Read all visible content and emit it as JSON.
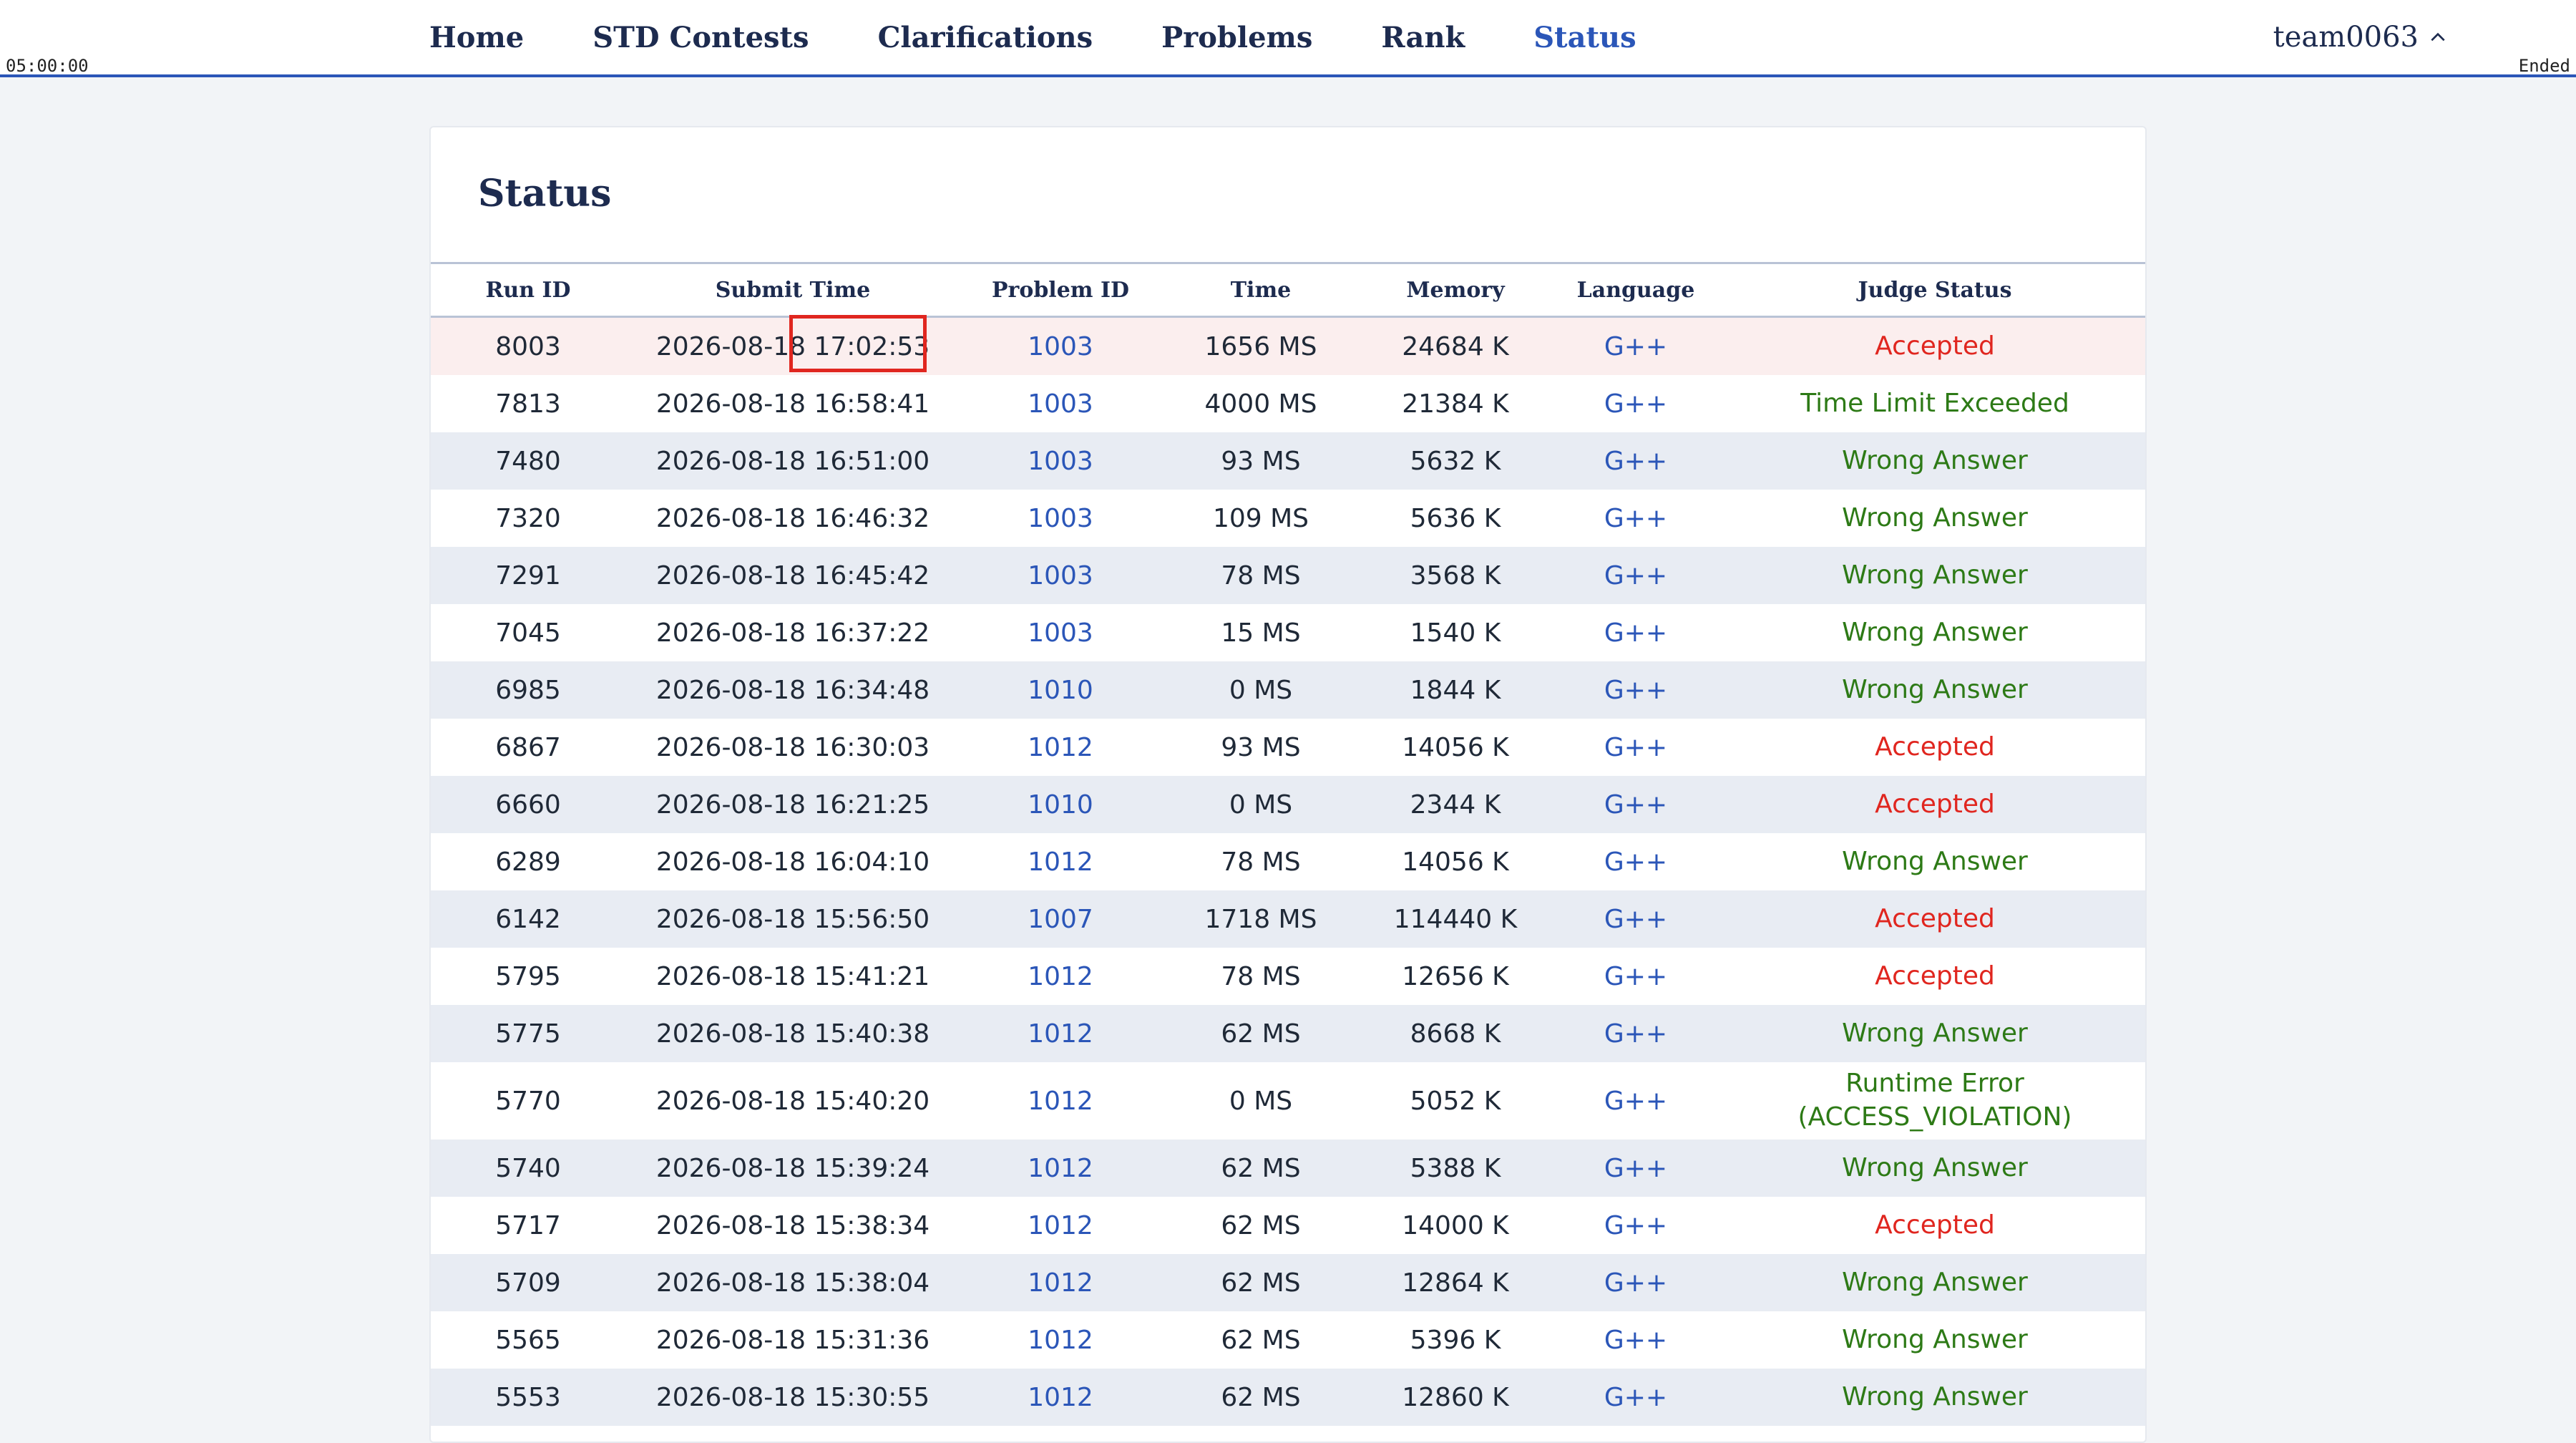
{
  "nav": {
    "items": [
      {
        "label": "Home",
        "active": false
      },
      {
        "label": "STD Contests",
        "active": false
      },
      {
        "label": "Clarifications",
        "active": false
      },
      {
        "label": "Problems",
        "active": false
      },
      {
        "label": "Rank",
        "active": false
      },
      {
        "label": "Status",
        "active": true
      }
    ],
    "timer": "05:00:00",
    "ended": "Ended",
    "user": "team0063",
    "user_icon": "chevron-up-icon"
  },
  "page": {
    "title": "Status"
  },
  "colors": {
    "accent": "#2b56b8",
    "accepted": "#e0261f",
    "rejected": "#2d7a16",
    "highlight_row": "#fbeeee"
  },
  "table": {
    "headers": [
      "Run ID",
      "Submit Time",
      "Problem ID",
      "Time",
      "Memory",
      "Language",
      "Judge Status"
    ],
    "rows": [
      {
        "run_id": "8003",
        "submit_time": "2026-08-18 17:02:53",
        "problem_id": "1003",
        "time": "1656 MS",
        "memory": "24684 K",
        "language": "G++",
        "status": "Accepted"
      },
      {
        "run_id": "7813",
        "submit_time": "2026-08-18 16:58:41",
        "problem_id": "1003",
        "time": "4000 MS",
        "memory": "21384 K",
        "language": "G++",
        "status": "Time Limit Exceeded"
      },
      {
        "run_id": "7480",
        "submit_time": "2026-08-18 16:51:00",
        "problem_id": "1003",
        "time": "93 MS",
        "memory": "5632 K",
        "language": "G++",
        "status": "Wrong Answer"
      },
      {
        "run_id": "7320",
        "submit_time": "2026-08-18 16:46:32",
        "problem_id": "1003",
        "time": "109 MS",
        "memory": "5636 K",
        "language": "G++",
        "status": "Wrong Answer"
      },
      {
        "run_id": "7291",
        "submit_time": "2026-08-18 16:45:42",
        "problem_id": "1003",
        "time": "78 MS",
        "memory": "3568 K",
        "language": "G++",
        "status": "Wrong Answer"
      },
      {
        "run_id": "7045",
        "submit_time": "2026-08-18 16:37:22",
        "problem_id": "1003",
        "time": "15 MS",
        "memory": "1540 K",
        "language": "G++",
        "status": "Wrong Answer"
      },
      {
        "run_id": "6985",
        "submit_time": "2026-08-18 16:34:48",
        "problem_id": "1010",
        "time": "0 MS",
        "memory": "1844 K",
        "language": "G++",
        "status": "Wrong Answer"
      },
      {
        "run_id": "6867",
        "submit_time": "2026-08-18 16:30:03",
        "problem_id": "1012",
        "time": "93 MS",
        "memory": "14056 K",
        "language": "G++",
        "status": "Accepted"
      },
      {
        "run_id": "6660",
        "submit_time": "2026-08-18 16:21:25",
        "problem_id": "1010",
        "time": "0 MS",
        "memory": "2344 K",
        "language": "G++",
        "status": "Accepted"
      },
      {
        "run_id": "6289",
        "submit_time": "2026-08-18 16:04:10",
        "problem_id": "1012",
        "time": "78 MS",
        "memory": "14056 K",
        "language": "G++",
        "status": "Wrong Answer"
      },
      {
        "run_id": "6142",
        "submit_time": "2026-08-18 15:56:50",
        "problem_id": "1007",
        "time": "1718 MS",
        "memory": "114440 K",
        "language": "G++",
        "status": "Accepted"
      },
      {
        "run_id": "5795",
        "submit_time": "2026-08-18 15:41:21",
        "problem_id": "1012",
        "time": "78 MS",
        "memory": "12656 K",
        "language": "G++",
        "status": "Accepted"
      },
      {
        "run_id": "5775",
        "submit_time": "2026-08-18 15:40:38",
        "problem_id": "1012",
        "time": "62 MS",
        "memory": "8668 K",
        "language": "G++",
        "status": "Wrong Answer"
      },
      {
        "run_id": "5770",
        "submit_time": "2026-08-18 15:40:20",
        "problem_id": "1012",
        "time": "0 MS",
        "memory": "5052 K",
        "language": "G++",
        "status": "Runtime Error",
        "status_detail": "(ACCESS_VIOLATION)"
      },
      {
        "run_id": "5740",
        "submit_time": "2026-08-18 15:39:24",
        "problem_id": "1012",
        "time": "62 MS",
        "memory": "5388 K",
        "language": "G++",
        "status": "Wrong Answer"
      },
      {
        "run_id": "5717",
        "submit_time": "2026-08-18 15:38:34",
        "problem_id": "1012",
        "time": "62 MS",
        "memory": "14000 K",
        "language": "G++",
        "status": "Accepted"
      },
      {
        "run_id": "5709",
        "submit_time": "2026-08-18 15:38:04",
        "problem_id": "1012",
        "time": "62 MS",
        "memory": "12864 K",
        "language": "G++",
        "status": "Wrong Answer"
      },
      {
        "run_id": "5565",
        "submit_time": "2026-08-18 15:31:36",
        "problem_id": "1012",
        "time": "62 MS",
        "memory": "5396 K",
        "language": "G++",
        "status": "Wrong Answer"
      },
      {
        "run_id": "5553",
        "submit_time": "2026-08-18 15:30:55",
        "problem_id": "1012",
        "time": "62 MS",
        "memory": "12860 K",
        "language": "G++",
        "status": "Wrong Answer"
      }
    ]
  }
}
